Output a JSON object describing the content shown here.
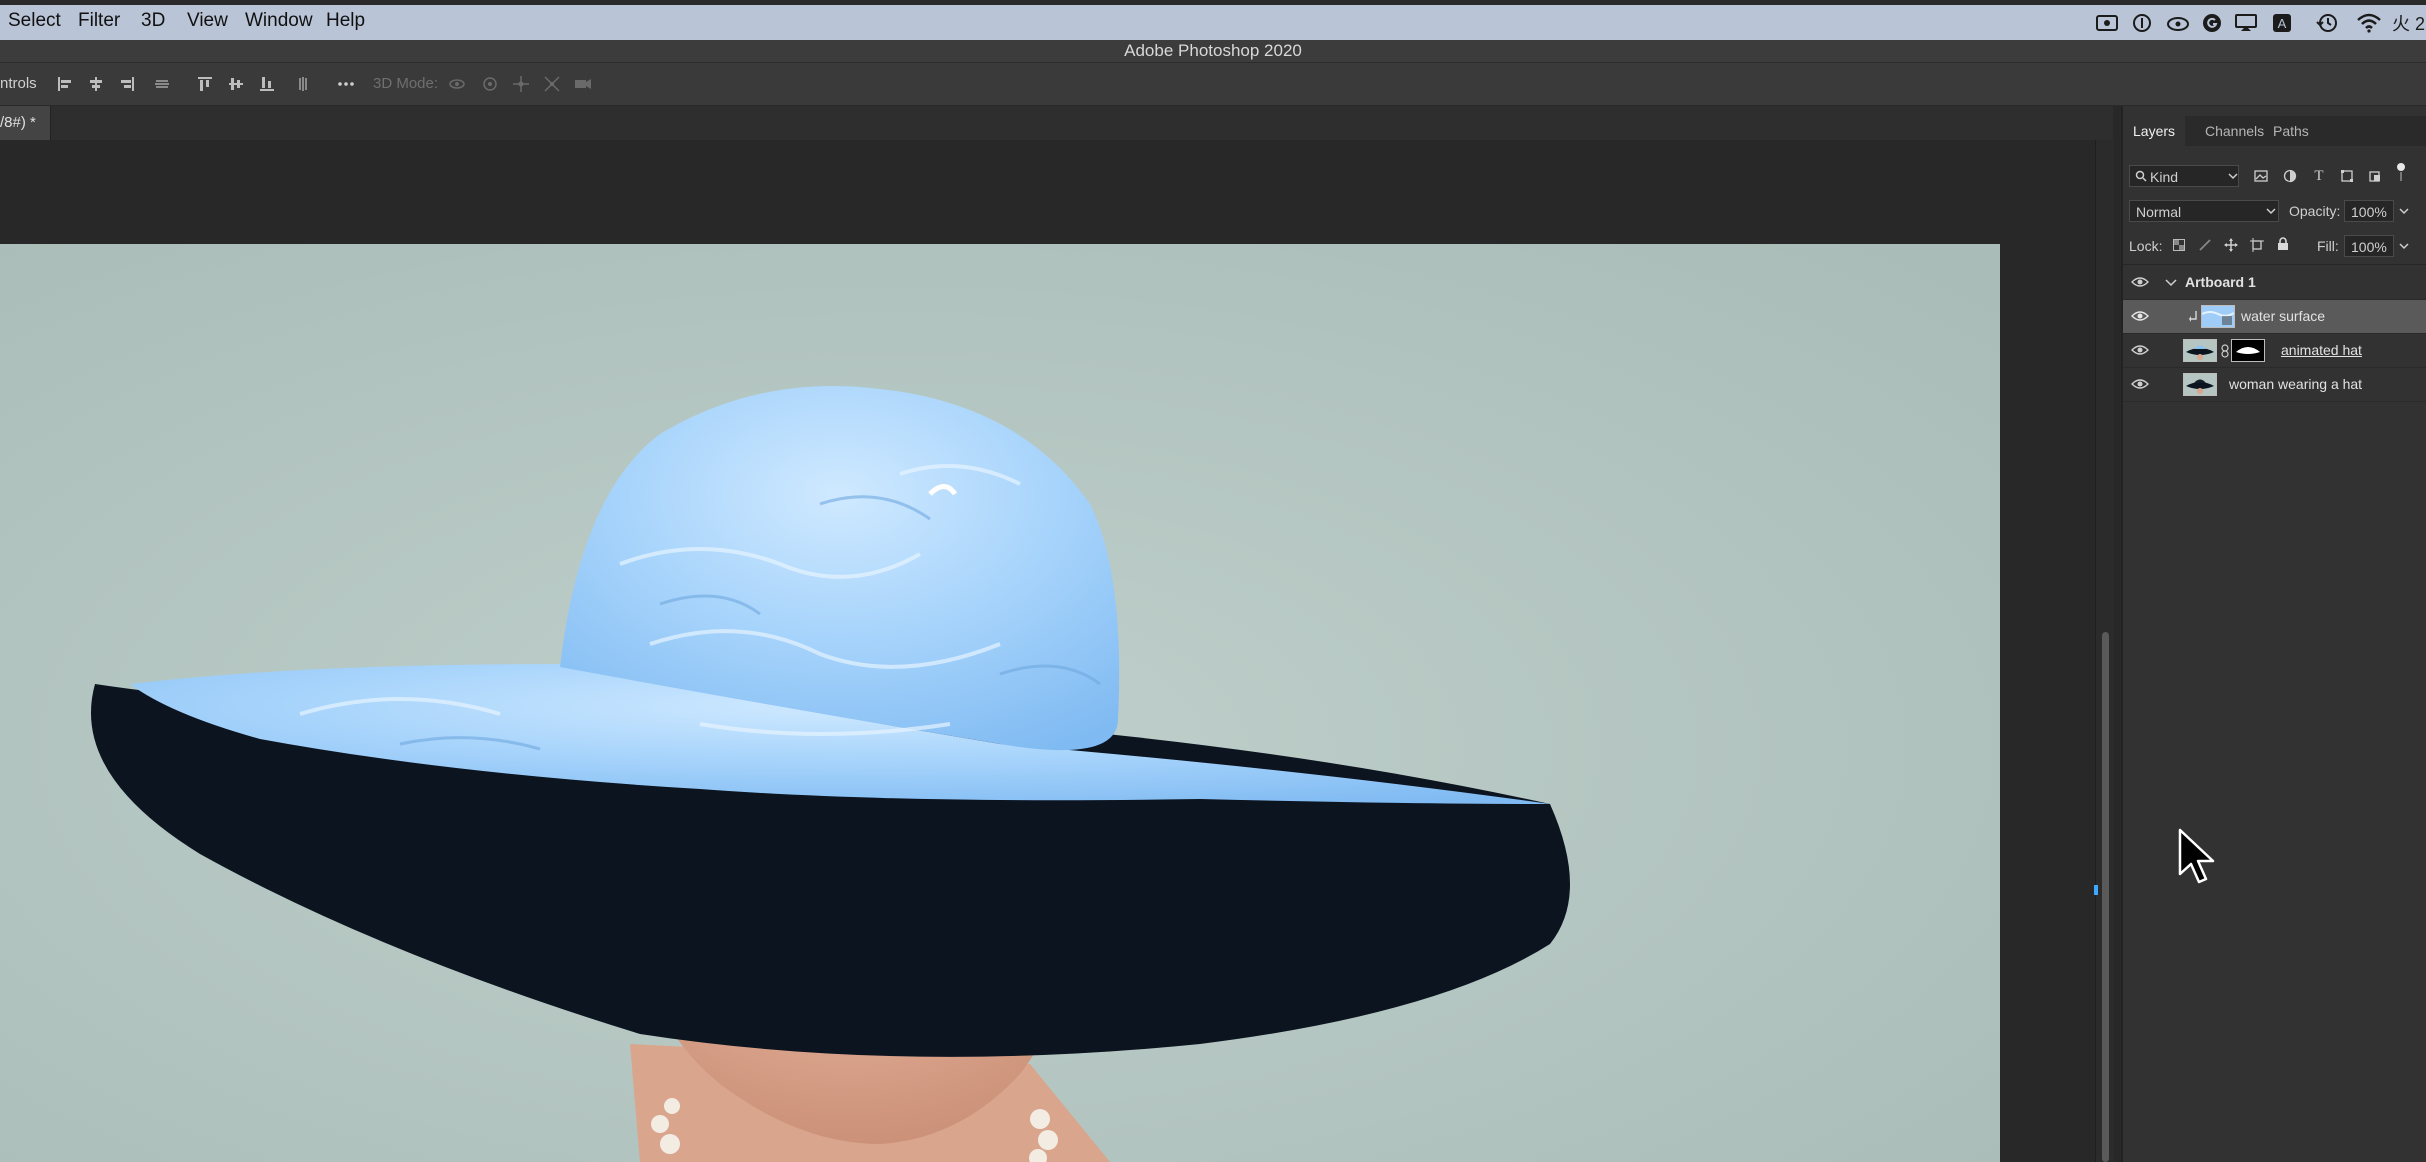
{
  "menubar": {
    "items": [
      "Select",
      "Filter",
      "3D",
      "View",
      "Window",
      "Help"
    ],
    "status_right_text": "火 2"
  },
  "window": {
    "title": "Adobe Photoshop 2020"
  },
  "options_bar": {
    "left_label": "ntrols",
    "mode_label": "3D Mode:"
  },
  "document": {
    "tab_label": "/8#) *"
  },
  "panel": {
    "tabs": [
      "Layers",
      "Channels",
      "Paths"
    ],
    "filter_kind": "Kind",
    "blend_mode": "Normal",
    "opacity_label": "Opacity:",
    "opacity_value": "100%",
    "lock_label": "Lock:",
    "fill_label": "Fill:",
    "fill_value": "100%",
    "layers": [
      {
        "name": "Artboard 1"
      },
      {
        "name": "water surface"
      },
      {
        "name": "animated hat"
      },
      {
        "name": "woman wearing a hat"
      }
    ]
  },
  "colors": {
    "canvas_bg": "#b4c5c1",
    "hat_water": "#a8d4fb",
    "hat_brim": "#0c1420",
    "lips": "#d42a22",
    "panel_bg": "#323232"
  }
}
